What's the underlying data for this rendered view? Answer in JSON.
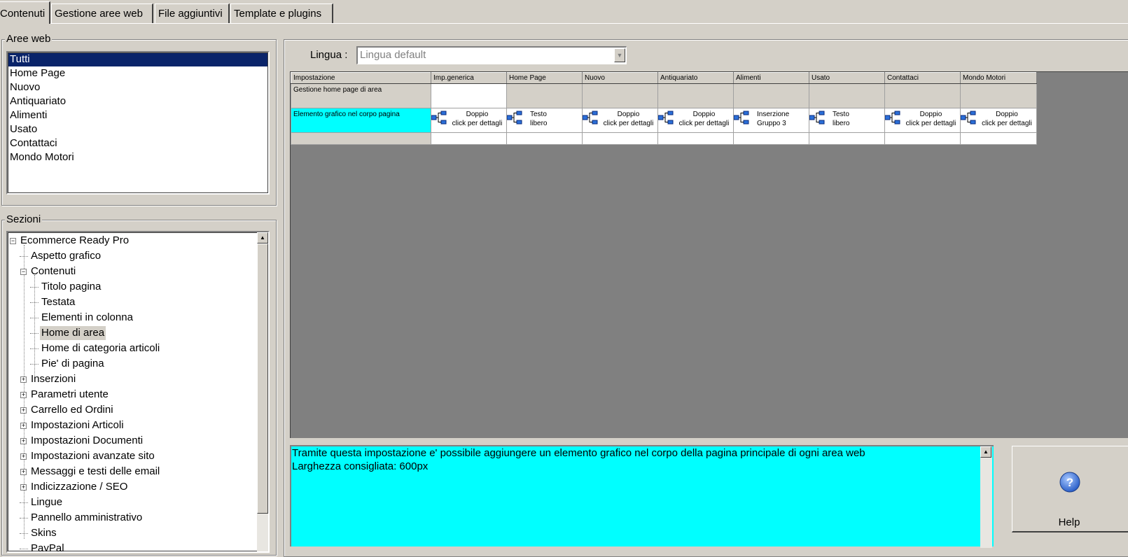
{
  "tabs": [
    {
      "label": "Contenuti",
      "active": true
    },
    {
      "label": "Gestione aree web",
      "active": false
    },
    {
      "label": "File aggiuntivi",
      "active": false
    },
    {
      "label": "Template e plugins",
      "active": false
    }
  ],
  "aree_web": {
    "legend": "Aree web",
    "items": [
      "Tutti",
      "Home Page",
      "Nuovo",
      "Antiquariato",
      "Alimenti",
      "Usato",
      "Contattaci",
      "Mondo Motori"
    ],
    "selected": "Tutti"
  },
  "sezioni": {
    "legend": "Sezioni",
    "nodes": [
      {
        "label": "Ecommerce Ready Pro",
        "expander": "−"
      },
      {
        "label": "Aspetto grafico"
      },
      {
        "label": "Contenuti",
        "expander": "−"
      },
      {
        "label": "Titolo pagina"
      },
      {
        "label": "Testata"
      },
      {
        "label": "Elementi in colonna"
      },
      {
        "label": "Home di area",
        "selected": true
      },
      {
        "label": "Home di categoria articoli"
      },
      {
        "label": "Pie' di pagina"
      },
      {
        "label": "Inserzioni",
        "expander": "+"
      },
      {
        "label": "Parametri utente",
        "expander": "+"
      },
      {
        "label": "Carrello ed Ordini",
        "expander": "+"
      },
      {
        "label": "Impostazioni Articoli",
        "expander": "+"
      },
      {
        "label": "Impostazioni Documenti",
        "expander": "+"
      },
      {
        "label": "Impostazioni avanzate sito",
        "expander": "+"
      },
      {
        "label": "Messaggi e testi delle email",
        "expander": "+"
      },
      {
        "label": "Indicizzazione / SEO",
        "expander": "+"
      },
      {
        "label": "Lingue"
      },
      {
        "label": "Pannello amministrativo"
      },
      {
        "label": "Skins"
      },
      {
        "label": "PayPal"
      }
    ]
  },
  "lingua": {
    "label": "Lingua :",
    "value": "Lingua default"
  },
  "grid": {
    "headers": [
      "Impostazione",
      "Imp.generica",
      "Home Page",
      "Nuovo",
      "Antiquariato",
      "Alimenti",
      "Usato",
      "Contattaci",
      "Mondo Motori"
    ],
    "row1": {
      "label": "Gestione home page di area"
    },
    "row2": {
      "label": "Elemento grafico nel corpo pagina",
      "cells": [
        {
          "line1": "Doppio",
          "line2": "click per dettagli",
          "align": "center"
        },
        {
          "line1": "Testo",
          "line2": "libero",
          "align": "left"
        },
        {
          "line1": "Doppio",
          "line2": "click per dettagli",
          "align": "center"
        },
        {
          "line1": "Doppio",
          "line2": "click per dettagli",
          "align": "center"
        },
        {
          "line1": "Inserzione",
          "line2": "Gruppo 3",
          "align": "left"
        },
        {
          "line1": "Testo",
          "line2": "libero",
          "align": "left"
        },
        {
          "line1": "Doppio",
          "line2": "click per dettagli",
          "align": "center"
        },
        {
          "line1": "Doppio",
          "line2": "click per dettagli",
          "align": "center"
        }
      ]
    }
  },
  "description": {
    "line1": "Tramite questa impostazione e' possibile aggiungere un elemento grafico nel corpo della pagina principale di ogni area web",
    "line2": "Larghezza consigliata: 600px"
  },
  "help": {
    "label": "Help"
  },
  "colors": {
    "window_bg": "#d4d0c8",
    "selection": "#0a246a",
    "highlight_cyan": "#00ffff",
    "grid_bg": "#808080"
  }
}
